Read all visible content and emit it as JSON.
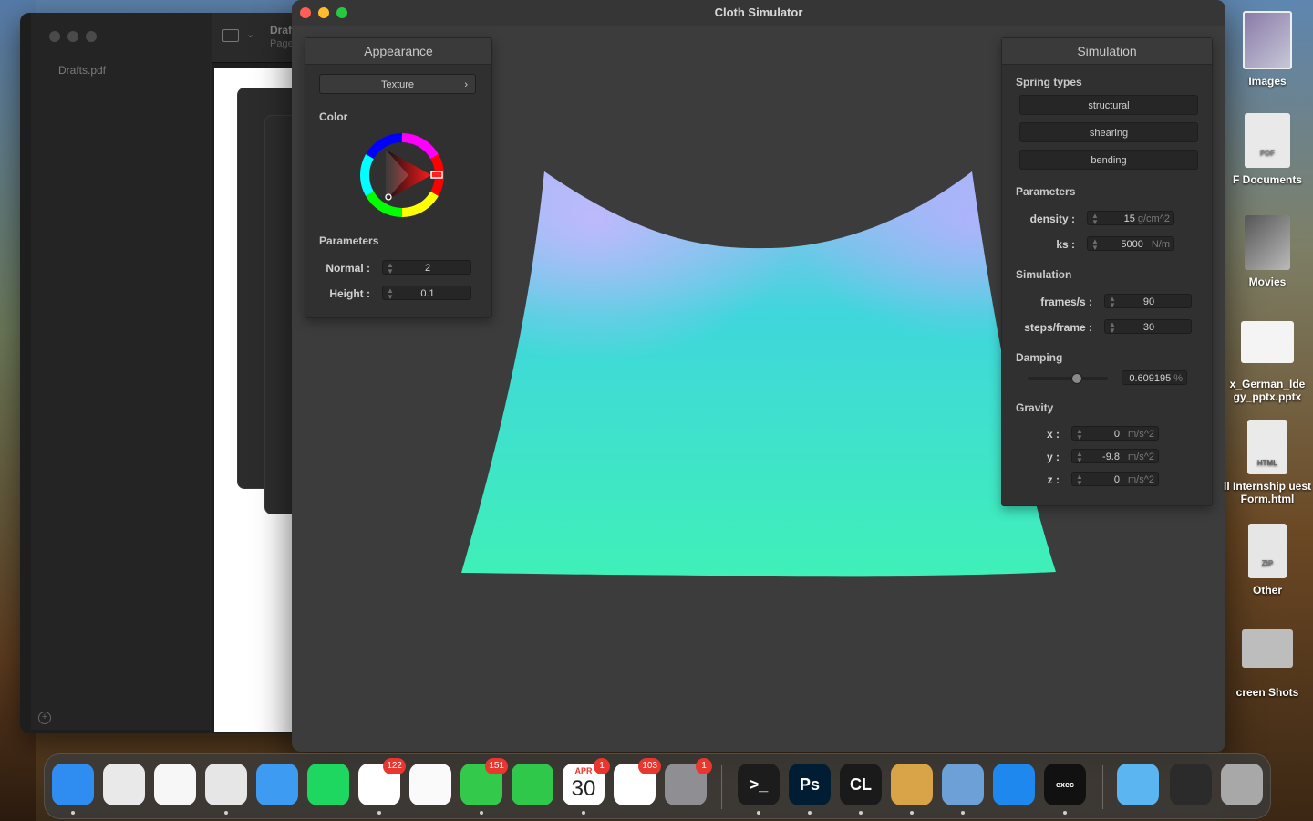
{
  "app": {
    "title": "Cloth Simulator"
  },
  "background_window": {
    "file_name": "Drafts.pdf",
    "title_partial": "Draf",
    "subtitle_partial": "Page"
  },
  "appearance": {
    "header": "Appearance",
    "texture_button": "Texture",
    "texture_chevron": "›",
    "color_label": "Color",
    "params_label": "Parameters",
    "normal_label": "Normal :",
    "normal_value": "2",
    "height_label": "Height :",
    "height_value": "0.1"
  },
  "simulation": {
    "header": "Simulation",
    "spring_types_label": "Spring types",
    "spring_types": [
      "structural",
      "shearing",
      "bending"
    ],
    "params_label": "Parameters",
    "density_label": "density :",
    "density_value": "15",
    "density_unit": "g/cm^2",
    "ks_label": "ks :",
    "ks_value": "5000",
    "ks_unit": "N/m",
    "sim_label": "Simulation",
    "fps_label": "frames/s :",
    "fps_value": "90",
    "steps_label": "steps/frame :",
    "steps_value": "30",
    "damping_label": "Damping",
    "damping_value": "0.609195",
    "damping_unit": "%",
    "gravity_label": "Gravity",
    "gx_label": "x :",
    "gx_value": "0",
    "gx_unit": "m/s^2",
    "gy_label": "y :",
    "gy_value": "-9.8",
    "gy_unit": "m/s^2",
    "gz_label": "z :",
    "gz_value": "0",
    "gz_unit": "m/s^2"
  },
  "desktop_icons": [
    "Images",
    "F Documents",
    "Movies",
    "x_German_Ide gy_pptx.pptx",
    "ll Internship uest Form.html",
    "Other",
    "creen Shots"
  ],
  "desktop_thumb_text": {
    "pdf": "PDF",
    "html": "HTML",
    "zip": "ZIP"
  },
  "dock": {
    "items": [
      {
        "name": "finder-icon",
        "color": "#2f8cf0"
      },
      {
        "name": "launchpad-icon",
        "color": "#e9e9e9"
      },
      {
        "name": "freeform-icon",
        "color": "#f7f7f7"
      },
      {
        "name": "chrome-icon",
        "color": "#e6e6e6"
      },
      {
        "name": "mail-icon",
        "color": "#3d9bf2"
      },
      {
        "name": "spotify-icon",
        "color": "#1ed760"
      },
      {
        "name": "slack-icon",
        "color": "#ffffff",
        "badge": "122"
      },
      {
        "name": "photos-icon",
        "color": "#fafafa"
      },
      {
        "name": "messages-icon",
        "color": "#33c94a",
        "badge": "151"
      },
      {
        "name": "facetime-icon",
        "color": "#2fc84b"
      },
      {
        "name": "calendar-icon",
        "color": "#ffffff",
        "badge": "1",
        "month": "APR",
        "day": "30"
      },
      {
        "name": "reminders-icon",
        "color": "#ffffff",
        "badge": "103"
      },
      {
        "name": "system-settings-icon",
        "color": "#8e8e93",
        "badge": "1"
      },
      {
        "name": "terminal-icon",
        "color": "#1c1c1c",
        "glyph": ">_"
      },
      {
        "name": "photoshop-icon",
        "color": "#001d34",
        "glyph": "Ps"
      },
      {
        "name": "clion-icon",
        "color": "#1a1a1a",
        "glyph": "CL"
      },
      {
        "name": "cyberduck-icon",
        "color": "#d9a448"
      },
      {
        "name": "preview-icon",
        "color": "#6da0d6"
      },
      {
        "name": "safari-icon",
        "color": "#1e88ef"
      },
      {
        "name": "exec-icon",
        "color": "#111111",
        "glyph": "exec"
      },
      {
        "name": "folder-icon",
        "color": "#5bb5f0"
      },
      {
        "name": "screenshot-icon",
        "color": "#2b2b2b"
      },
      {
        "name": "trash-icon",
        "color": "#a8a8a8"
      }
    ]
  },
  "colors": {
    "cloth_top": "#9fb8f5",
    "cloth_mid": "#3fd6dc",
    "cloth_bottom": "#3ff0b8",
    "close": "#ff5f57",
    "minimize": "#febc2e",
    "zoom": "#28c840",
    "badge": "#e8372e"
  }
}
